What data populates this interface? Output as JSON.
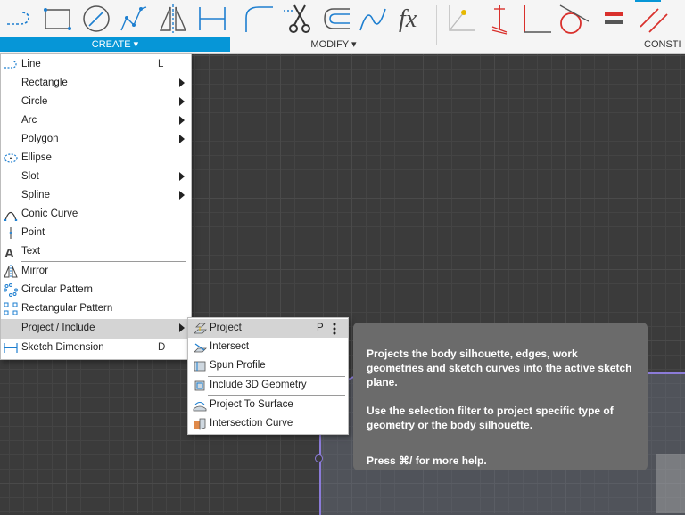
{
  "toolbar": {
    "groups": {
      "create": "CREATE ▾",
      "modify": "MODIFY ▾",
      "constrain": "CONSTI"
    },
    "tools": [
      {
        "icon": "line-icon"
      },
      {
        "icon": "rectangle-icon"
      },
      {
        "icon": "circle-icon"
      },
      {
        "icon": "spline-icon"
      },
      {
        "icon": "mirror-icon"
      },
      {
        "icon": "sketch-dimension-icon"
      },
      {
        "icon": "fillet-icon"
      },
      {
        "icon": "trim-icon"
      },
      {
        "icon": "offset-icon"
      },
      {
        "icon": "curve-icon"
      },
      {
        "icon": "function-icon"
      },
      {
        "icon": "horizontal-vertical-icon"
      },
      {
        "icon": "coincident-icon"
      },
      {
        "icon": "perpendicular-icon"
      },
      {
        "icon": "tangent-icon"
      },
      {
        "icon": "equal-icon"
      },
      {
        "icon": "parallel-icon"
      }
    ]
  },
  "create_menu": {
    "items": [
      {
        "label": "Line",
        "shortcut": "L",
        "icon": "line-icon"
      },
      {
        "label": "Rectangle",
        "submenu": true
      },
      {
        "label": "Circle",
        "submenu": true
      },
      {
        "label": "Arc",
        "submenu": true
      },
      {
        "label": "Polygon",
        "submenu": true
      },
      {
        "label": "Ellipse",
        "icon": "ellipse-icon"
      },
      {
        "label": "Slot",
        "submenu": true
      },
      {
        "label": "Spline",
        "submenu": true
      },
      {
        "label": "Conic Curve",
        "icon": "conic-curve-icon"
      },
      {
        "label": "Point",
        "icon": "point-icon"
      },
      {
        "label": "Text",
        "icon": "text-icon"
      },
      {
        "label": "Mirror",
        "icon": "mirror-icon"
      },
      {
        "label": "Circular Pattern",
        "icon": "circular-pattern-icon"
      },
      {
        "label": "Rectangular Pattern",
        "icon": "rectangular-pattern-icon"
      },
      {
        "label": "Project / Include",
        "submenu": true,
        "active": true
      },
      {
        "label": "Sketch Dimension",
        "shortcut": "D",
        "icon": "sketch-dimension-icon"
      }
    ]
  },
  "project_submenu": {
    "items": [
      {
        "label": "Project",
        "shortcut": "P",
        "icon": "project-icon",
        "active": true
      },
      {
        "label": "Intersect",
        "icon": "intersect-icon"
      },
      {
        "label": "Spun Profile",
        "icon": "spun-profile-icon"
      },
      {
        "label": "Include 3D Geometry",
        "icon": "include-3d-geometry-icon"
      },
      {
        "label": "Project To Surface",
        "icon": "project-to-surface-icon"
      },
      {
        "label": "Intersection Curve",
        "icon": "intersection-curve-icon"
      }
    ]
  },
  "tooltip": {
    "description": "Projects the body silhouette, edges, work geometries and sketch curves into the active sketch plane.",
    "hint": "Use the selection filter to project specific type of geometry or the body silhouette.",
    "help": "Press ⌘/ for more help."
  },
  "colors": {
    "accent": "#0696d7",
    "tooltip_bg": "#6b6b6b",
    "sketch": "#8b7bd8",
    "constraint_red": "#d9302c"
  }
}
